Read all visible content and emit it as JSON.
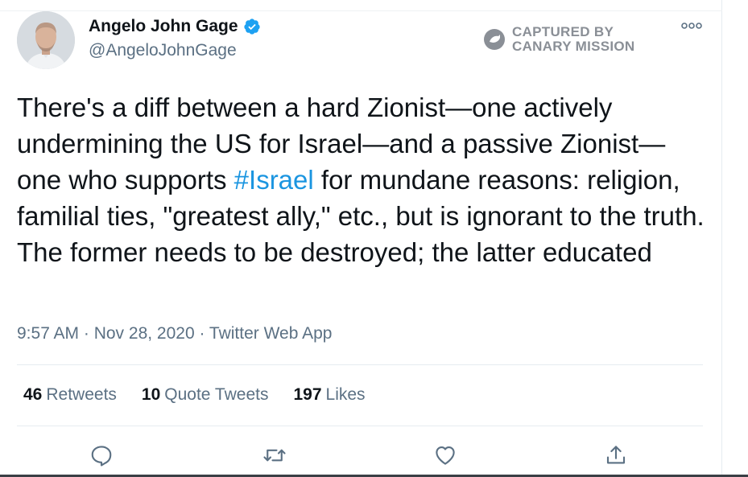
{
  "tweet": {
    "author": {
      "name": "Angelo John Gage",
      "handle": "@AngeloJohnGage",
      "verified": true
    },
    "text_parts": {
      "before_hashtag": "There's a diff between a hard Zionist—one actively undermining the US for Israel—and a passive Zionist—one who supports ",
      "hashtag": "#Israel",
      "after_hashtag": " for mundane reasons: religion, familial ties, \"greatest ally,\" etc., but is ignorant to the truth. The former needs to be destroyed; the latter educated"
    },
    "meta": "9:57 AM · Nov 28, 2020 · Twitter Web App",
    "stats": {
      "retweets_count": "46",
      "retweets_label": "Retweets",
      "quotes_count": "10",
      "quotes_label": "Quote Tweets",
      "likes_count": "197",
      "likes_label": "Likes"
    },
    "actions": [
      "reply-icon",
      "retweet-icon",
      "like-icon",
      "share-icon"
    ]
  },
  "watermark": {
    "line1": "CAPTURED BY",
    "line2": "CANARY MISSION"
  },
  "colors": {
    "text": "#0f1419",
    "secondary": "#5b7083",
    "link": "#1b95e0",
    "verified": "#1da1f2",
    "icon": "#5b7083"
  }
}
